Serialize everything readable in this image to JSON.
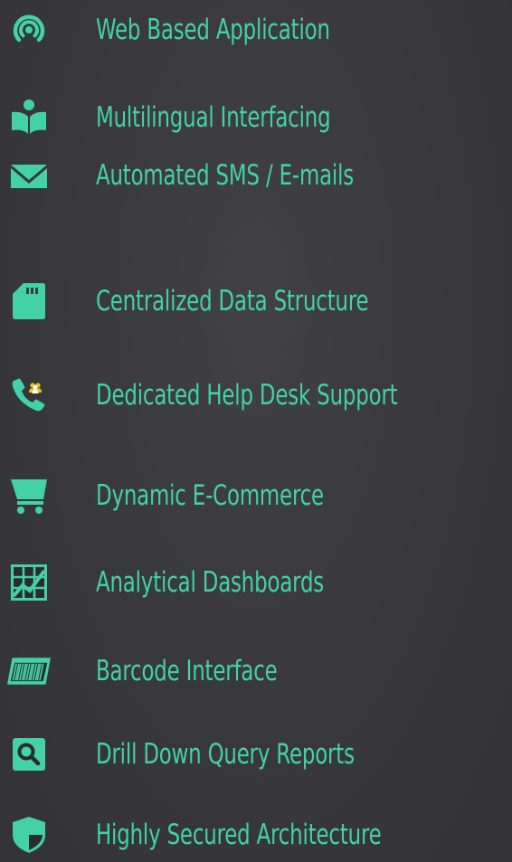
{
  "accent_color": "#42d2a6",
  "background_color": "#3a3a3d",
  "features": [
    {
      "label": "Web Based Application",
      "icon": "broadcast-signal-icon"
    },
    {
      "label": "Multilingual Interfacing",
      "icon": "reader-book-icon"
    },
    {
      "label": "Automated SMS / E-mails",
      "icon": "envelope-icon"
    },
    {
      "label": "Centralized Data Structure",
      "icon": "sd-card-icon"
    },
    {
      "label": "Dedicated Help Desk Support",
      "icon": "support-phone-icon"
    },
    {
      "label": "Dynamic E-Commerce",
      "icon": "shopping-cart-icon"
    },
    {
      "label": "Analytical Dashboards",
      "icon": "chart-grid-icon"
    },
    {
      "label": "Barcode Interface",
      "icon": "barcode-icon"
    },
    {
      "label": "Drill Down Query Reports",
      "icon": "search-icon"
    },
    {
      "label": "Highly Secured Architecture",
      "icon": "shield-icon"
    }
  ]
}
